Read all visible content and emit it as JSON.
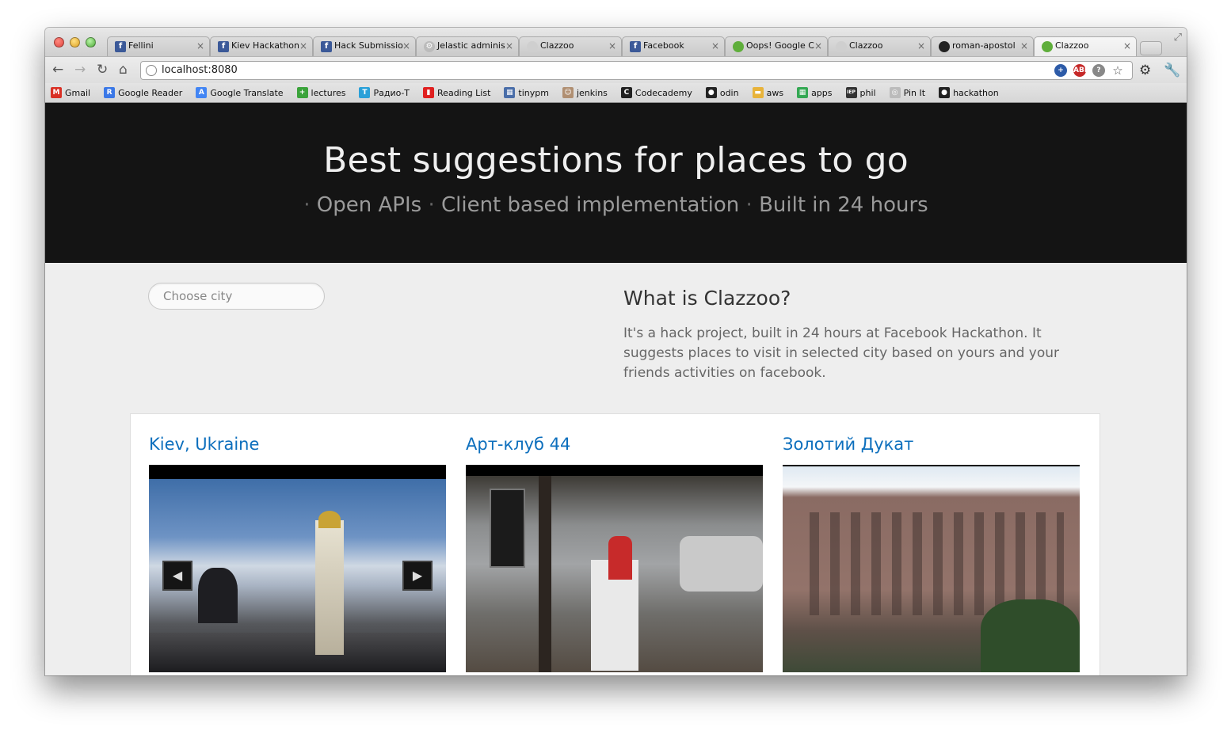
{
  "browser": {
    "tabs": [
      {
        "title": "Fellini",
        "favicon": "facebook-icon"
      },
      {
        "title": "Kiev Hackathon",
        "favicon": "facebook-icon"
      },
      {
        "title": "Hack Submissio",
        "favicon": "facebook-icon"
      },
      {
        "title": "Jelastic adminis",
        "favicon": "gear-icon"
      },
      {
        "title": "Clazzoo",
        "favicon": "clazzoo-icon"
      },
      {
        "title": "Facebook",
        "favicon": "facebook-icon"
      },
      {
        "title": "Oops! Google C",
        "favicon": "clazzoo-icon"
      },
      {
        "title": "Clazzoo",
        "favicon": "clazzoo-icon"
      },
      {
        "title": "roman-apostol",
        "favicon": "github-icon"
      },
      {
        "title": "Clazzoo",
        "favicon": "clazzoo-icon",
        "active": true
      }
    ],
    "address": "localhost:8080",
    "bookmarks": [
      {
        "label": "Gmail",
        "icon": "gmail-icon",
        "color": "#d93025",
        "glyph": "M"
      },
      {
        "label": "Google Reader",
        "icon": "reader-icon",
        "color": "#3b78e7",
        "glyph": "R"
      },
      {
        "label": "Google Translate",
        "icon": "translate-icon",
        "color": "#4285f4",
        "glyph": "A"
      },
      {
        "label": "lectures",
        "icon": "lectures-icon",
        "color": "#3aa33a",
        "glyph": "+"
      },
      {
        "label": "Радио-Т",
        "icon": "radio-icon",
        "color": "#2aa0d8",
        "glyph": "T"
      },
      {
        "label": "Reading List",
        "icon": "bookmark-icon",
        "color": "#e02020",
        "glyph": "▮"
      },
      {
        "label": "tinypm",
        "icon": "tinypm-icon",
        "color": "#4a6ea9",
        "glyph": "▦"
      },
      {
        "label": "jenkins",
        "icon": "jenkins-icon",
        "color": "#b08f72",
        "glyph": "☺"
      },
      {
        "label": "Codecademy",
        "icon": "codecademy-icon",
        "color": "#222222",
        "glyph": "C"
      },
      {
        "label": "odin",
        "icon": "github-icon",
        "color": "#222222",
        "glyph": "●"
      },
      {
        "label": "aws",
        "icon": "folder-icon",
        "color": "#e8b33a",
        "glyph": "▬"
      },
      {
        "label": "apps",
        "icon": "apps-icon",
        "color": "#34a853",
        "glyph": "▦"
      },
      {
        "label": "phil",
        "icon": "iep-icon",
        "color": "#333333",
        "glyph": "IEP"
      },
      {
        "label": "Pin It",
        "icon": "pin-icon",
        "color": "#bbbbbb",
        "glyph": "◎"
      },
      {
        "label": "hackathon",
        "icon": "github-icon",
        "color": "#222222",
        "glyph": "●"
      }
    ]
  },
  "hero": {
    "title": "Best suggestions for places to go",
    "features": [
      "Open APIs",
      "Client based implementation",
      "Built in 24 hours"
    ]
  },
  "search": {
    "placeholder": "Choose city"
  },
  "about": {
    "heading": "What is Clazzoo?",
    "text": "It's a hack project, built in 24 hours at Facebook Hackathon. It suggests places to visit in selected city based on yours and your friends activities on facebook."
  },
  "cards": [
    {
      "title": "Kiev, Ukraine"
    },
    {
      "title": "Арт-клуб 44"
    },
    {
      "title": "Золотий Дукат"
    }
  ],
  "colors": {
    "link": "#0d6fbd",
    "hero_bg": "#141414"
  }
}
